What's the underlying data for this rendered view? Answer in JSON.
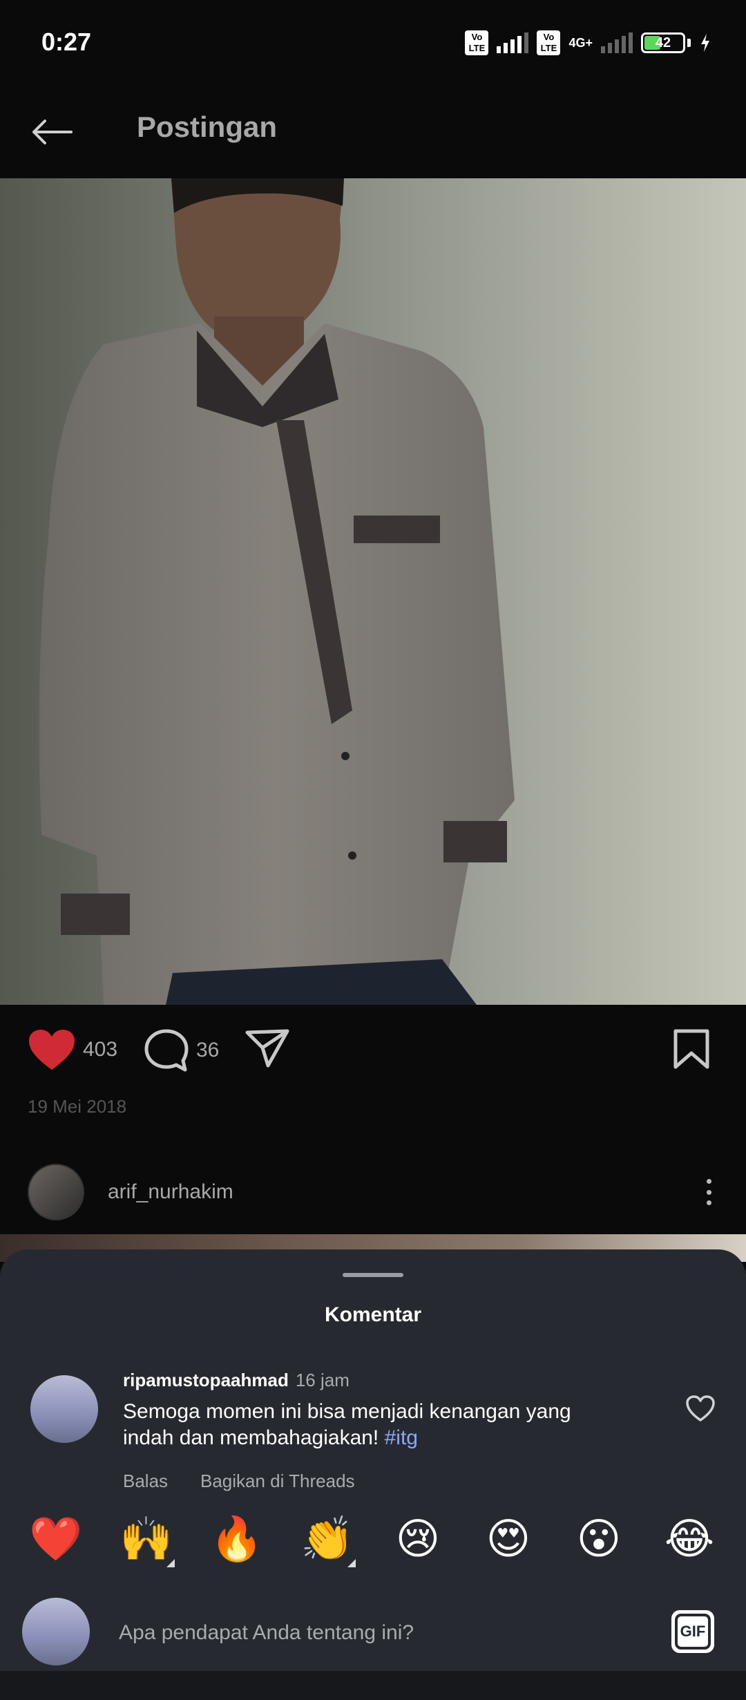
{
  "status_bar": {
    "time": "0:27",
    "volte_label": "Vo LTE",
    "network_label": "4G+",
    "battery_level": "42",
    "battery_fraction": 0.42
  },
  "app_bar": {
    "title": "Postingan",
    "back_icon": "arrow-left-icon"
  },
  "post": {
    "like_count": "403",
    "comment_count": "36",
    "date": "19 Mei 2018",
    "colors": {
      "heart": "#e0353f",
      "background": "#0a0a0b"
    }
  },
  "author": {
    "username": "arif_nurhakim"
  },
  "comments_sheet": {
    "title": "Komentar",
    "comments": [
      {
        "username": "ripamustopaahmad",
        "time": "16 jam",
        "text": "Semoga momen ini bisa menjadi kenangan yang indah dan membahagiakan! ",
        "hashtag": "#itg",
        "reply_label": "Balas",
        "share_label": "Bagikan di Threads"
      }
    ],
    "emojis": [
      "❤️",
      "🙌",
      "🔥",
      "👏",
      "😢",
      "😍",
      "😮",
      "😂"
    ],
    "input_placeholder": "Apa pendapat Anda tentang ini?",
    "gif_label": "GIF",
    "colors": {
      "sheet": "#262a30",
      "hashtag": "#8fa6ff"
    }
  }
}
